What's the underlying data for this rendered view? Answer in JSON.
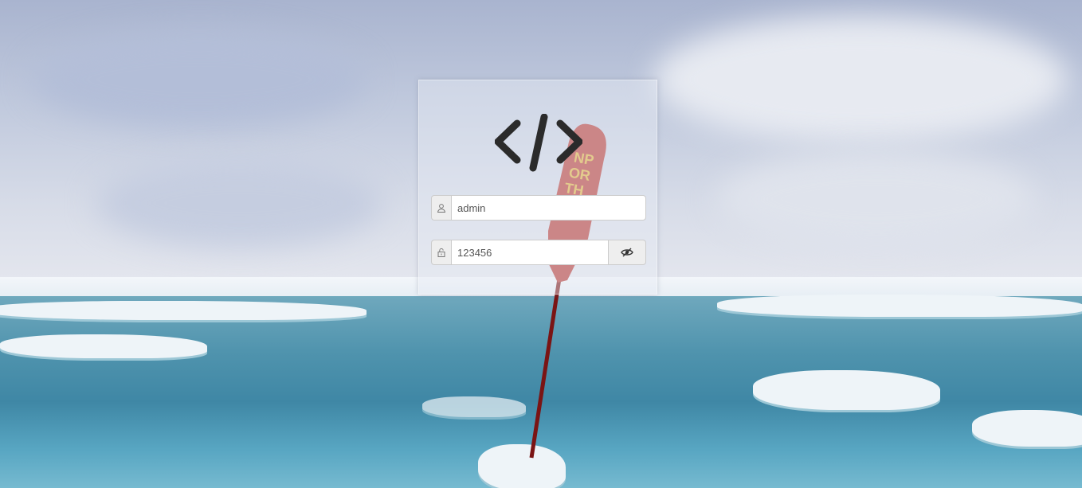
{
  "login": {
    "logo_icon": "code-brackets-icon",
    "username": {
      "icon": "user-icon",
      "value": "admin",
      "placeholder": ""
    },
    "password": {
      "icon": "lock-icon",
      "value": "123456",
      "placeholder": "",
      "toggle_icon": "eye-slash-icon"
    }
  },
  "background": {
    "scene": "arctic-ice-with-pole-flag"
  },
  "colors": {
    "icon_dark": "#2b2b2b",
    "input_border": "#cccccc",
    "addon_bg": "#eeeeee",
    "flag_red": "#b4342e",
    "flag_text": "#e0b13a"
  }
}
